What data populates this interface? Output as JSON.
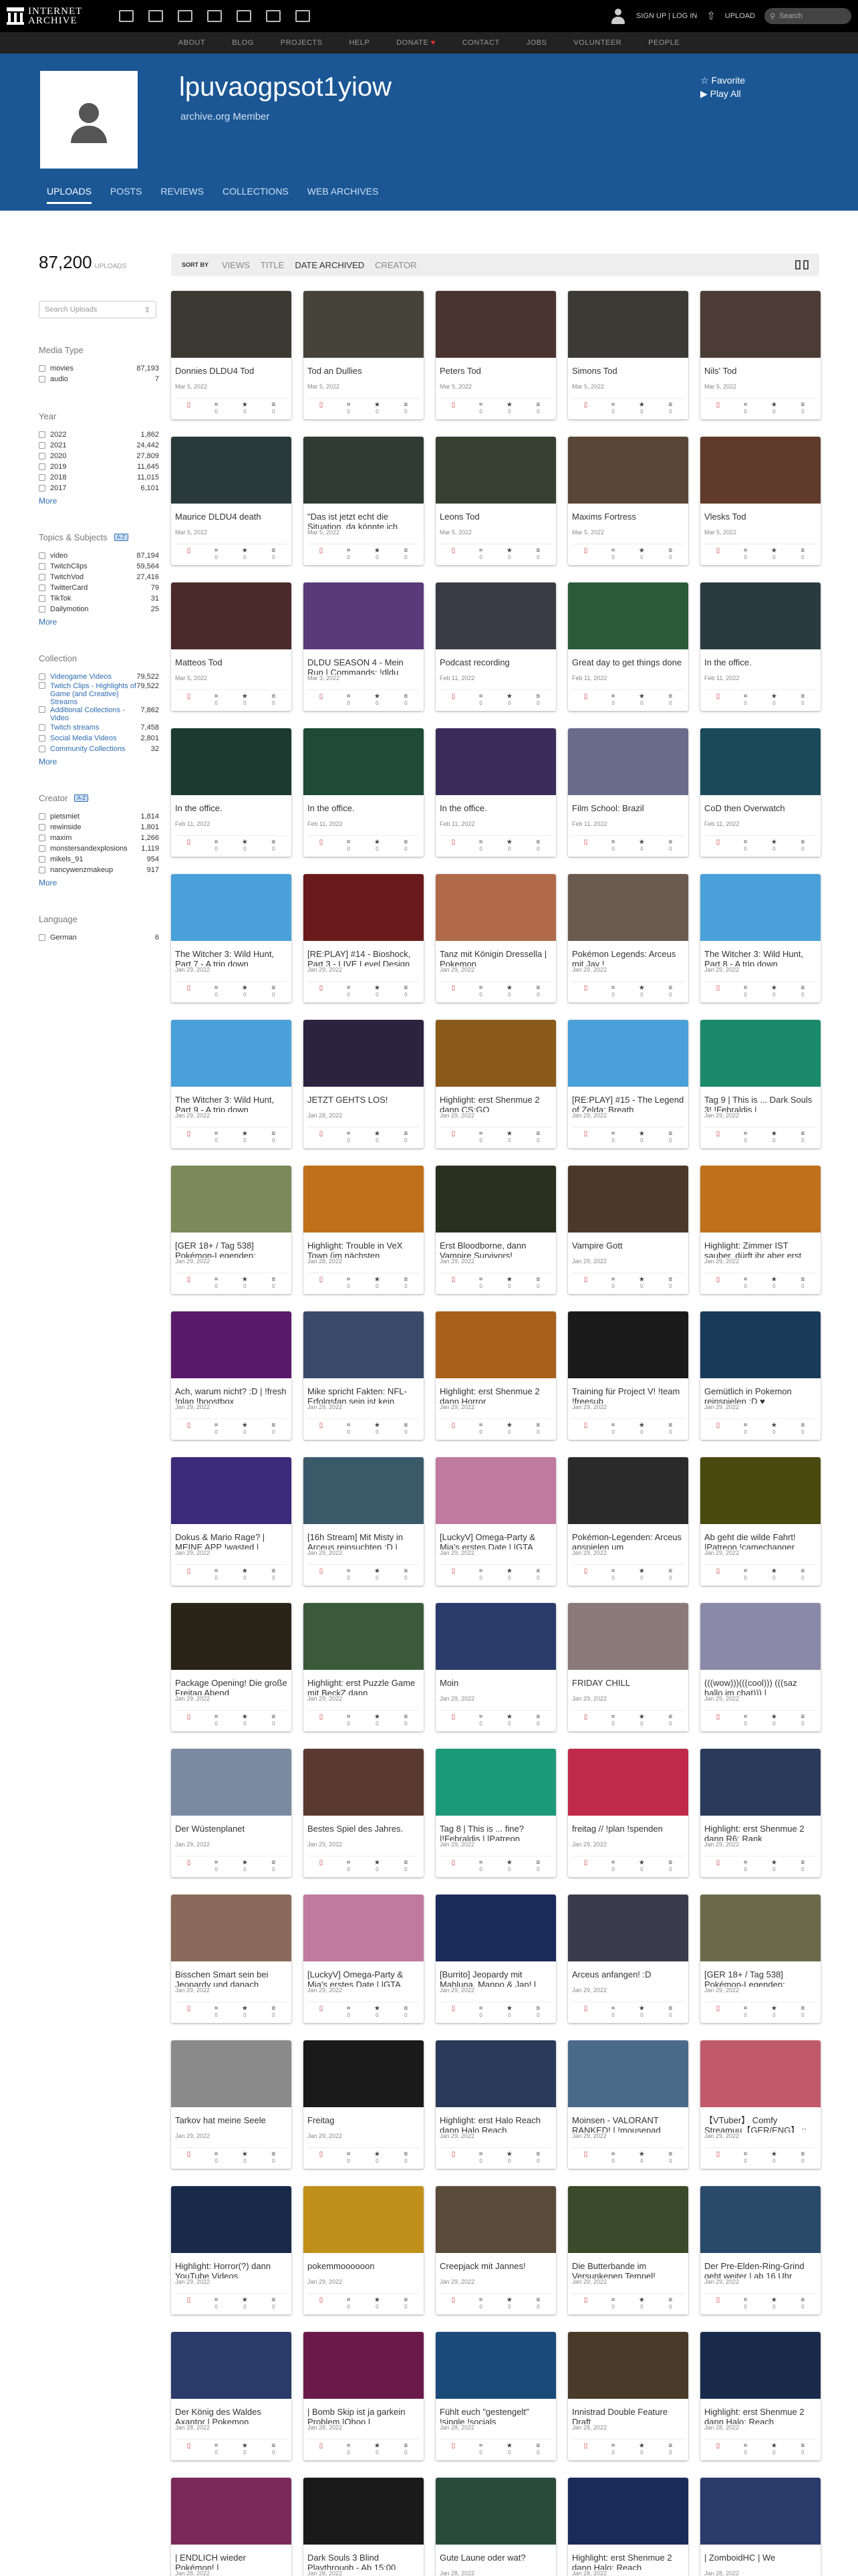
{
  "header": {
    "logo_line1": "INTERNET",
    "logo_line2": "ARCHIVE",
    "signin": "SIGN UP | LOG IN",
    "upload": "UPLOAD",
    "search_placeholder": "Search"
  },
  "subnav": [
    "ABOUT",
    "BLOG",
    "PROJECTS",
    "HELP",
    "DONATE",
    "CONTACT",
    "JOBS",
    "VOLUNTEER",
    "PEOPLE"
  ],
  "profile": {
    "username": "lpuvaogpsot1yiow",
    "role": "archive.org Member",
    "favorite": "☆ Favorite",
    "playall": "▶ Play All"
  },
  "tabs": [
    "UPLOADS",
    "POSTS",
    "REVIEWS",
    "COLLECTIONS",
    "WEB ARCHIVES"
  ],
  "sidebar": {
    "count": "87,200",
    "count_label": "UPLOADS",
    "search_placeholder": "Search Uploads",
    "media": {
      "title": "Media Type",
      "items": [
        {
          "label": "movies",
          "n": "87,193"
        },
        {
          "label": "audio",
          "n": "7"
        }
      ]
    },
    "year": {
      "title": "Year",
      "items": [
        {
          "label": "2022",
          "n": "1,862"
        },
        {
          "label": "2021",
          "n": "24,442"
        },
        {
          "label": "2020",
          "n": "27,809"
        },
        {
          "label": "2019",
          "n": "11,645"
        },
        {
          "label": "2018",
          "n": "11,015"
        },
        {
          "label": "2017",
          "n": "6,101"
        }
      ],
      "more": "More"
    },
    "topics": {
      "title": "Topics & Subjects",
      "items": [
        {
          "label": "video",
          "n": "87,194"
        },
        {
          "label": "TwitchClips",
          "n": "59,564"
        },
        {
          "label": "TwitchVod",
          "n": "27,416"
        },
        {
          "label": "TwitterCard",
          "n": "79"
        },
        {
          "label": "TikTok",
          "n": "31"
        },
        {
          "label": "Dailymotion",
          "n": "25"
        }
      ],
      "more": "More"
    },
    "collection": {
      "title": "Collection",
      "items": [
        {
          "label": "Videogame Videos",
          "n": "79,522"
        },
        {
          "label": "Twitch Clips - Highlights of Game (and Creative) Streams",
          "n": "79,522"
        },
        {
          "label": "Additional Collections - Video",
          "n": "7,862"
        },
        {
          "label": "Twitch streams",
          "n": "7,458"
        },
        {
          "label": "Social Media Videos",
          "n": "2,801"
        },
        {
          "label": "Community Collections",
          "n": "32"
        }
      ],
      "more": "More"
    },
    "creator": {
      "title": "Creator",
      "items": [
        {
          "label": "pietsmiet",
          "n": "1,814"
        },
        {
          "label": "rewinside",
          "n": "1,801"
        },
        {
          "label": "maxim",
          "n": "1,266"
        },
        {
          "label": "monstersandexplosions",
          "n": "1,119"
        },
        {
          "label": "mikels_91",
          "n": "954"
        },
        {
          "label": "nancywenzmakeup",
          "n": "917"
        }
      ],
      "more": "More"
    },
    "language": {
      "title": "Language",
      "items": [
        {
          "label": "German",
          "n": "6"
        }
      ]
    }
  },
  "sortbar": {
    "label": "SORT BY",
    "options": [
      "VIEWS",
      "TITLE",
      "DATE ARCHIVED",
      "CREATOR"
    ]
  },
  "items": [
    {
      "t": "Donnies DLDU4 Tod",
      "d": "Mar 5, 2022",
      "c": "#3a3a32"
    },
    {
      "t": "Tod an Dullies",
      "d": "Mar 5, 2022",
      "c": "#46443a"
    },
    {
      "t": "Peters Tod",
      "d": "Mar 5, 2022",
      "c": "#4a3430"
    },
    {
      "t": "Simons Tod",
      "d": "Mar 5, 2022",
      "c": "#3c3a34"
    },
    {
      "t": "Nils' Tod",
      "d": "Mar 5, 2022",
      "c": "#4b3d36"
    },
    {
      "t": "Maurice DLDU4 death",
      "d": "Mar 5, 2022",
      "c": "#2a3a3a"
    },
    {
      "t": "\"Das ist jetzt echt die Situation, da könnte ich",
      "d": "Mar 5, 2022",
      "c": "#2f3b35"
    },
    {
      "t": "Leons Tod",
      "d": "Mar 5, 2022",
      "c": "#354030"
    },
    {
      "t": "Maxims Fortress",
      "d": "Mar 5, 2022",
      "c": "#5a4636"
    },
    {
      "t": "Vlesks Tod",
      "d": "Mar 5, 2022",
      "c": "#603a2a"
    },
    {
      "t": "Matteos Tod",
      "d": "Mar 5, 2022",
      "c": "#4a2a2a"
    },
    {
      "t": "DLDU SEASON 4 - Mein Run | Commands: !dldu",
      "d": "Mar 3, 2022",
      "c": "#5b3a7a"
    },
    {
      "t": "Podcast recording",
      "d": "Feb 11, 2022",
      "c": "#3a3a44"
    },
    {
      "t": "Great day to get things done",
      "d": "Feb 11, 2022",
      "c": "#2b5a3a"
    },
    {
      "t": "In the office.",
      "d": "Feb 11, 2022",
      "c": "#2a3a40"
    },
    {
      "t": "In the office.",
      "d": "Feb 11, 2022",
      "c": "#1c3a30"
    },
    {
      "t": "In the office.",
      "d": "Feb 11, 2022",
      "c": "#1e4a36"
    },
    {
      "t": "In the office.",
      "d": "Feb 11, 2022",
      "c": "#3a2c5a"
    },
    {
      "t": "Film School: Brazil",
      "d": "Feb 11, 2022",
      "c": "#6a6a8a"
    },
    {
      "t": "CoD then Overwatch",
      "d": "Feb 11, 2022",
      "c": "#1a4a5a"
    },
    {
      "t": "The Witcher 3: Wild Hunt, Part 7 - A trip down",
      "d": "Jan 29, 2022",
      "c": "#4aa0d8"
    },
    {
      "t": "[RE:PLAY] #14 - Bioshock, Part 3 - LIVE Level Design",
      "d": "Jan 29, 2022",
      "c": "#6a1a1a"
    },
    {
      "t": "Tanz mit Königin Dressella | Pokemon",
      "d": "Jan 29, 2022",
      "c": "#b06a4a"
    },
    {
      "t": "Pokémon Legends: Arceus mit Jay !",
      "d": "Jan 29, 2022",
      "c": "#6a5a50"
    },
    {
      "t": "The Witcher 3: Wild Hunt, Part 8 - A trip down",
      "d": "Jan 29, 2022",
      "c": "#4aa0d8"
    },
    {
      "t": "The Witcher 3: Wild Hunt, Part 9 - A trip down",
      "d": "Jan 29, 2022",
      "c": "#4aa0d8"
    },
    {
      "t": "JETZT GEHTS LOS!",
      "d": "Jan 28, 2022",
      "c": "#2a2440"
    },
    {
      "t": "Highlight: erst Shenmue 2 dann CS:GO",
      "d": "Jan 29, 2022",
      "c": "#8a5a1a"
    },
    {
      "t": "[RE:PLAY] #15 - The Legend of Zelda: Breath",
      "d": "Jan 29, 2022",
      "c": "#4aa0d8"
    },
    {
      "t": "Tag 9 | This is ... Dark Souls 3! !Febraldis |",
      "d": "Jan 29, 2022",
      "c": "#1a8a6a"
    },
    {
      "t": "[GER 18+ / Tag 538] Pokémon-Legenden:",
      "d": "Jan 29, 2022",
      "c": "#7a8a5a"
    },
    {
      "t": "Highlight: Trouble in VeX Town (im nächsten",
      "d": "Jan 28, 2022",
      "c": "#c0701a"
    },
    {
      "t": "Erst Bloodborne, dann Vampire Survivors!",
      "d": "Jan 29, 2022",
      "c": "#2a3020"
    },
    {
      "t": "Vampire Gott",
      "d": "Jan 29, 2022",
      "c": "#4a3828"
    },
    {
      "t": "Highlight: Zimmer IST sauber, dürft ihr aber erst",
      "d": "Jan 29, 2022",
      "c": "#c0701a"
    },
    {
      "t": "Ach, warum nicht? :D | !fresh !plan !boostbox",
      "d": "Jan 29, 2022",
      "c": "#5a1a6a"
    },
    {
      "t": "Mike spricht Fakten: NFL-Erfolgsfan sein ist kein",
      "d": "Jan 29, 2022",
      "c": "#3a4a6a"
    },
    {
      "t": "Highlight: erst Shenmue 2 dann Horror",
      "d": "Jan 29, 2022",
      "c": "#a8601a"
    },
    {
      "t": "Training für Project V! !team !freesub",
      "d": "Jan 29, 2022",
      "c": "#1a1a1a"
    },
    {
      "t": "Gemütlich in Pokemon reinspielen :D ♥",
      "d": "Jan 29, 2022",
      "c": "#1a3a5a"
    },
    {
      "t": "Dokus & Mario Rage? | MEINE APP !wasted |",
      "d": "Jan 29, 2022",
      "c": "#3a2a7a"
    },
    {
      "t": "[16h Stream] Mit Misty in Arceus reinsuchten :D |",
      "d": "Jan 29, 2022",
      "c": "#3a5a6a"
    },
    {
      "t": "[LuckyV] Omega-Party & Mia's erstes Date | |GTA",
      "d": "Jan 29, 2022",
      "c": "#c07aa0"
    },
    {
      "t": "Pokémon-Legenden: Arceus anspielen um",
      "d": "Jan 29, 2022",
      "c": "#2a2a2a"
    },
    {
      "t": "Ab geht die wilde Fahrt! |Patreon !camechanger",
      "d": "Jan 29, 2022",
      "c": "#4a4a10"
    },
    {
      "t": "Package Opening! Die große Freitag Abend",
      "d": "Jan 29, 2022",
      "c": "#2a2418"
    },
    {
      "t": "Highlight: erst Puzzle Game mit BeckZ dann",
      "d": "Jan 29, 2022",
      "c": "#3a5a3a"
    },
    {
      "t": "Moin",
      "d": "Jan 29, 2022",
      "c": "#2a3a6a"
    },
    {
      "t": "FRIDAY CHILL",
      "d": "Jan 29, 2022",
      "c": "#8a7a7a"
    },
    {
      "t": "(((wow)))(((cool))) (((saz hallo im chat))) |",
      "d": "Jan 29, 2022",
      "c": "#8a8aa8"
    },
    {
      "t": "Der Wüstenplanet",
      "d": "Jan 29, 2022",
      "c": "#7a8aa0"
    },
    {
      "t": "Bestes Spiel des Jahres.",
      "d": "Jan 29, 2022",
      "c": "#5a3a30"
    },
    {
      "t": "Tag 8 | This is ... fine? |!Febraldis | |Patreon",
      "d": "Jan 29, 2022",
      "c": "#1a9a7a"
    },
    {
      "t": "freitag // !plan !spenden",
      "d": "Jan 29, 2022",
      "c": "#c02a4a"
    },
    {
      "t": "Highlight: erst Shenmue 2 dann R6: Rank",
      "d": "Jan 29, 2022",
      "c": "#2a3a5a"
    },
    {
      "t": "Bisschen Smart sein bei Jeopardy und danach",
      "d": "Jan 29, 2022",
      "c": "#8a6a5a"
    },
    {
      "t": "[LuckyV] Omega-Party & Mia's erstes Date | |GTA",
      "d": "Jan 29, 2022",
      "c": "#c07aa0"
    },
    {
      "t": "[Burrito] Jeopardy mit Mahluna, Manpo & Jan! |",
      "d": "Jan 29, 2022",
      "c": "#1a2a5a"
    },
    {
      "t": "Arceus anfangen! :D",
      "d": "Jan 29, 2022",
      "c": "#3a3a4a"
    },
    {
      "t": "[GER 18+ / Tag 538] Pokémon-Legenden:",
      "d": "Jan 29, 2022",
      "c": "#6a6a4a"
    },
    {
      "t": "Tarkov hat meine Seele",
      "d": "Jan 29, 2022",
      "c": "#8a8a8a"
    },
    {
      "t": "Freitag",
      "d": "Jan 29, 2022",
      "c": "#1a1a1a"
    },
    {
      "t": "Highlight: erst Halo Reach dann Halo Reach",
      "d": "Jan 29, 2022",
      "c": "#2a3a5a"
    },
    {
      "t": "Moinsen - VALORANT RANKED! | !mousepad",
      "d": "Jan 29, 2022",
      "c": "#4a6a8a"
    },
    {
      "t": "【VTuber】 Comfy Streamuu【GER/ENG】 ::",
      "d": "Jan 29, 2022",
      "c": "#c05a6a"
    },
    {
      "t": "Highlight: Horror(?) dann YouTube Videos",
      "d": "Jan 29, 2022",
      "c": "#1a2a4a"
    },
    {
      "t": "pokemmoooooon",
      "d": "Jan 29, 2022",
      "c": "#c0901a"
    },
    {
      "t": "Creepjack mit Jannes!",
      "d": "Jan 29, 2022",
      "c": "#5a4a3a"
    },
    {
      "t": "Die Butterbande im Versunkenen Tempel!",
      "d": "Jan 29, 2022",
      "c": "#3a4a2a"
    },
    {
      "t": "Der Pre-Elden-Ring-Grind geht weiter | ab 16 Uhr",
      "d": "Jan 29, 2022",
      "c": "#2a4a6a"
    },
    {
      "t": "Der König des Waldes Axantor | Pokemon",
      "d": "Jan 28, 2022",
      "c": "#2a3a6a"
    },
    {
      "t": "| Bomb Skip ist ja garkein Problem |Ohoo |",
      "d": "Jan 28, 2022",
      "c": "#6a1a4a"
    },
    {
      "t": "Fühlt euch \"gestengelt\" !single !socials",
      "d": "Jan 28, 2022",
      "c": "#1a4a7a"
    },
    {
      "t": "Innistrad Double Feature Draft",
      "d": "Jan 28, 2022",
      "c": "#4a3a2a"
    },
    {
      "t": "Highlight: erst Shenmue 2 dann Halo: Reach",
      "d": "Jan 28, 2022",
      "c": "#1a2a4a"
    },
    {
      "t": "| ENDLICH wieder Pokémon! |",
      "d": "Jan 28, 2022",
      "c": "#7a2a5a"
    },
    {
      "t": "Dark Souls 3 Blind Playthrough - Ab 15:00",
      "d": "Jan 28, 2022",
      "c": "#1a1a1a"
    },
    {
      "t": "Gute Laune oder wat?",
      "d": "Jan 28, 2022",
      "c": "#2a4a3a"
    },
    {
      "t": "Highlight: erst Shenmue 2 dann Halo: Reach",
      "d": "Jan 28, 2022",
      "c": "#1a2a5a"
    },
    {
      "t": "| ZomboidHC | We",
      "d": "Jan 28, 2022",
      "c": "#2a3a6a"
    }
  ]
}
